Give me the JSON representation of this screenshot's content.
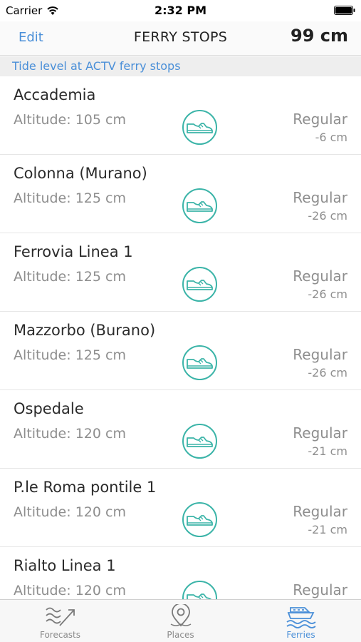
{
  "status_bar": {
    "carrier": "Carrier",
    "time": "2:32 PM"
  },
  "nav": {
    "edit_label": "Edit",
    "title": "FERRY STOPS",
    "tide_level": "99 cm"
  },
  "section": {
    "header": "Tide level at ACTV ferry stops"
  },
  "stops": [
    {
      "name": "Accademia",
      "altitude": "Altitude: 105 cm",
      "status": "Regular",
      "diff": "-6 cm",
      "icon": "shoe-icon"
    },
    {
      "name": "Colonna (Murano)",
      "altitude": "Altitude: 125 cm",
      "status": "Regular",
      "diff": "-26 cm",
      "icon": "shoe-icon"
    },
    {
      "name": "Ferrovia Linea 1",
      "altitude": "Altitude: 125 cm",
      "status": "Regular",
      "diff": "-26 cm",
      "icon": "shoe-icon"
    },
    {
      "name": "Mazzorbo (Burano)",
      "altitude": "Altitude: 125 cm",
      "status": "Regular",
      "diff": "-26 cm",
      "icon": "shoe-icon"
    },
    {
      "name": "Ospedale",
      "altitude": "Altitude: 120 cm",
      "status": "Regular",
      "diff": "-21 cm",
      "icon": "shoe-icon"
    },
    {
      "name": "P.le Roma pontile 1",
      "altitude": "Altitude: 120 cm",
      "status": "Regular",
      "diff": "-21 cm",
      "icon": "shoe-icon"
    },
    {
      "name": "Rialto Linea 1",
      "altitude": "Altitude: 120 cm",
      "status": "Regular",
      "diff": "",
      "icon": "shoe-icon"
    }
  ],
  "tabs": [
    {
      "label": "Forecasts",
      "icon": "forecast-waves-icon",
      "active": false
    },
    {
      "label": "Places",
      "icon": "map-pin-icon",
      "active": false
    },
    {
      "label": "Ferries",
      "icon": "ferry-icon",
      "active": true
    }
  ],
  "colors": {
    "accent": "#4a8fd8",
    "icon_teal": "#3bb4a8",
    "text_secondary": "#8e8e8e"
  }
}
